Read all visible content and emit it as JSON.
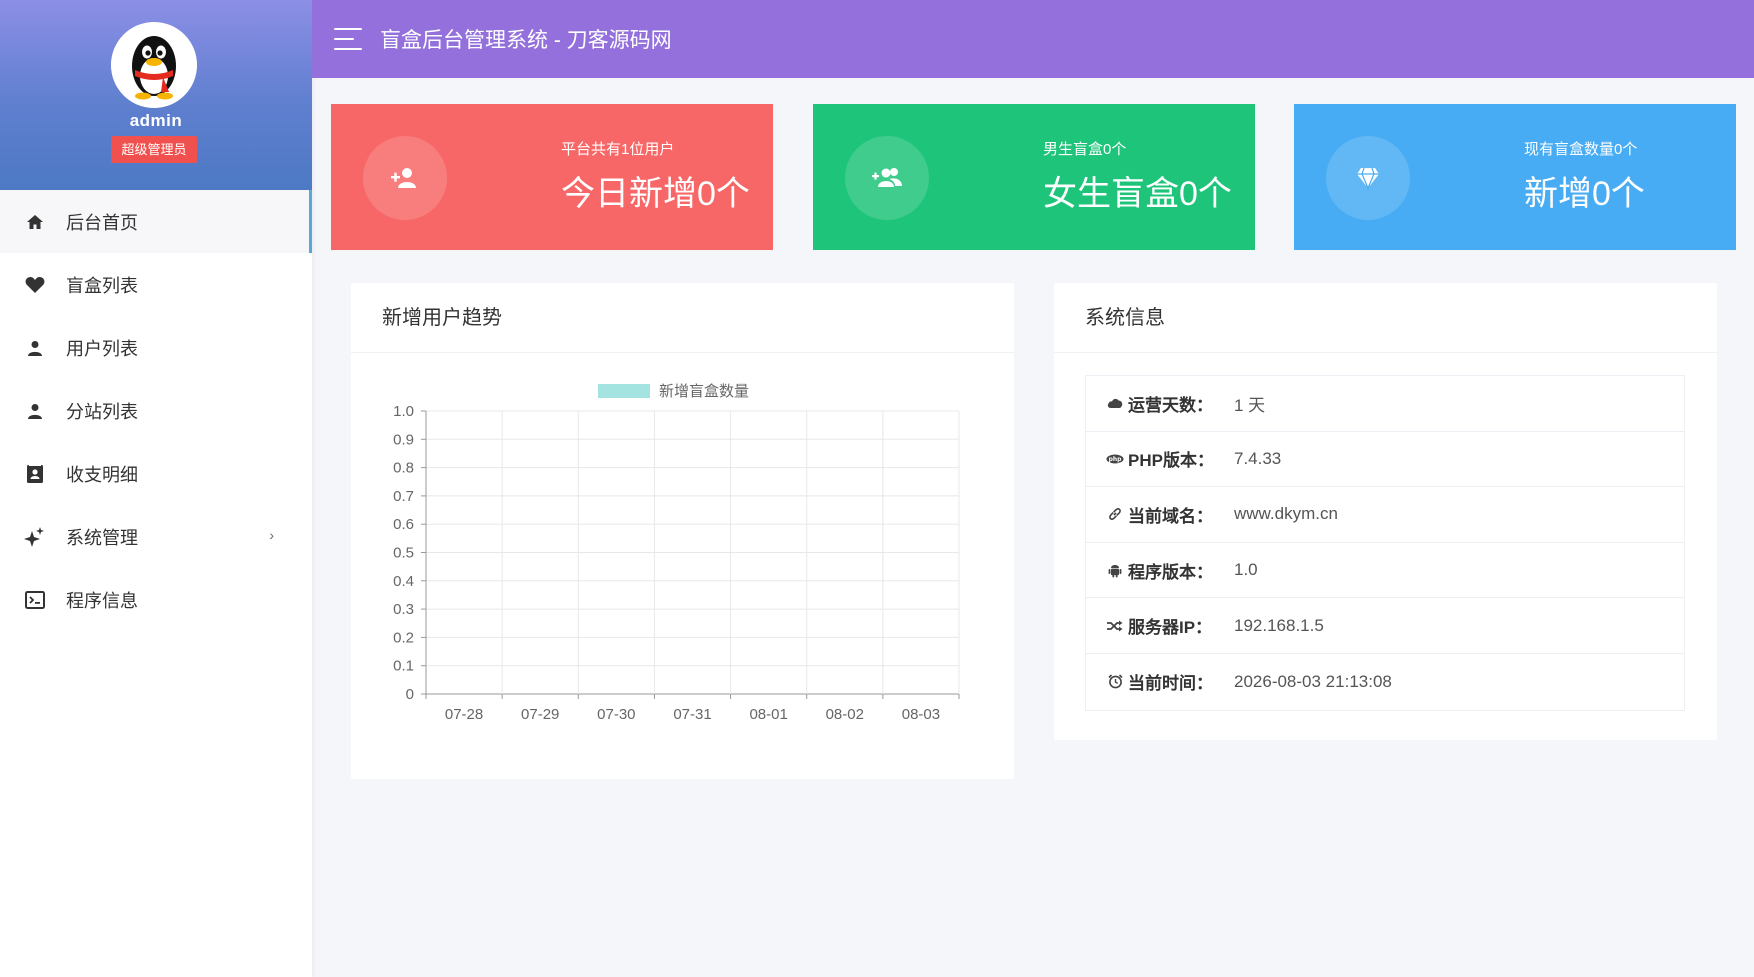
{
  "app": {
    "title": "盲盒后台管理系统 - 刀客源码网"
  },
  "user": {
    "name": "admin",
    "role": "超级管理员"
  },
  "sidebar": {
    "items": [
      {
        "label": "后台首页",
        "icon": "home-icon",
        "active": true
      },
      {
        "label": "盲盒列表",
        "icon": "heart-icon"
      },
      {
        "label": "用户列表",
        "icon": "user-icon"
      },
      {
        "label": "分站列表",
        "icon": "user-icon"
      },
      {
        "label": "收支明细",
        "icon": "contact-book-icon"
      },
      {
        "label": "系统管理",
        "icon": "sparkle-icon",
        "has_submenu": true,
        "chevron": "›"
      },
      {
        "label": "程序信息",
        "icon": "terminal-icon"
      }
    ]
  },
  "stats": [
    {
      "small": "平台共有1位用户",
      "big": "今日新增0个",
      "icon": "user-plus-icon",
      "color": "#f76767"
    },
    {
      "small": "男生盲盒0个",
      "big": "女生盲盒0个",
      "icon": "users-plus-icon",
      "color": "#1ec47a"
    },
    {
      "small": "现有盲盒数量0个",
      "big": "新增0个",
      "icon": "diamond-icon",
      "color": "#47acf3"
    }
  ],
  "chart_panel": {
    "title": "新增用户趋势"
  },
  "chart_data": {
    "type": "line",
    "title": "",
    "xlabel": "",
    "ylabel": "",
    "categories": [
      "07-28",
      "07-29",
      "07-30",
      "07-31",
      "08-01",
      "08-02",
      "08-03"
    ],
    "series": [
      {
        "name": "新增盲盒数量",
        "values": [],
        "color": "#a3e4e1"
      }
    ],
    "ylim": [
      0,
      1.0
    ],
    "yticks": [
      "0",
      "0.1",
      "0.2",
      "0.3",
      "0.4",
      "0.5",
      "0.6",
      "0.7",
      "0.8",
      "0.9",
      "1.0"
    ],
    "grid": true,
    "legend": "top-center"
  },
  "info_panel": {
    "title": "系统信息",
    "rows": [
      {
        "icon": "cloud-icon",
        "label": "运营天数：",
        "value": "1 天"
      },
      {
        "icon": "php-icon",
        "label": "PHP版本：",
        "value": "7.4.33"
      },
      {
        "icon": "link-icon",
        "label": "当前域名：",
        "value": "www.dkym.cn"
      },
      {
        "icon": "android-icon",
        "label": "程序版本：",
        "value": "1.0"
      },
      {
        "icon": "shuffle-icon",
        "label": "服务器IP：",
        "value": "192.168.1.5"
      },
      {
        "icon": "clock-icon",
        "label": "当前时间：",
        "value": "2026-08-03 21:13:08"
      }
    ]
  }
}
